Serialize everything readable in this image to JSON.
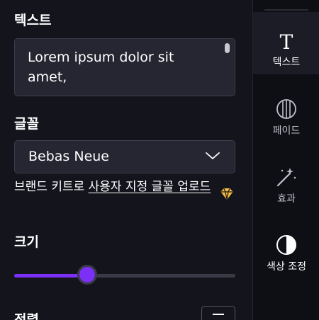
{
  "panel": {
    "text_section_title": "텍스트",
    "text_content": "Lorem ipsum dolor sit amet,",
    "font_section_title": "글꼴",
    "font_select_value": "Bebas Neue",
    "brand_kit_prefix": "브랜드 키트로 ",
    "brand_kit_link": "사용자 지정 글꼴 업로드",
    "size_section_title": "크기",
    "size_slider_fraction": 0.33,
    "align_section_title": "정렬"
  },
  "rail": {
    "items": [
      {
        "label": "텍스트",
        "icon": "text-T-icon",
        "active": true
      },
      {
        "label": "페이드",
        "icon": "fade-circle-icon",
        "active": false
      },
      {
        "label": "효과",
        "icon": "magic-wand-icon",
        "active": false
      },
      {
        "label": "색상 조정",
        "icon": "contrast-circle-icon",
        "active": false
      }
    ]
  },
  "colors": {
    "accent": "#7b2ff7",
    "premium": "#f4b942",
    "background": "#13141c",
    "field_background": "#252632"
  }
}
